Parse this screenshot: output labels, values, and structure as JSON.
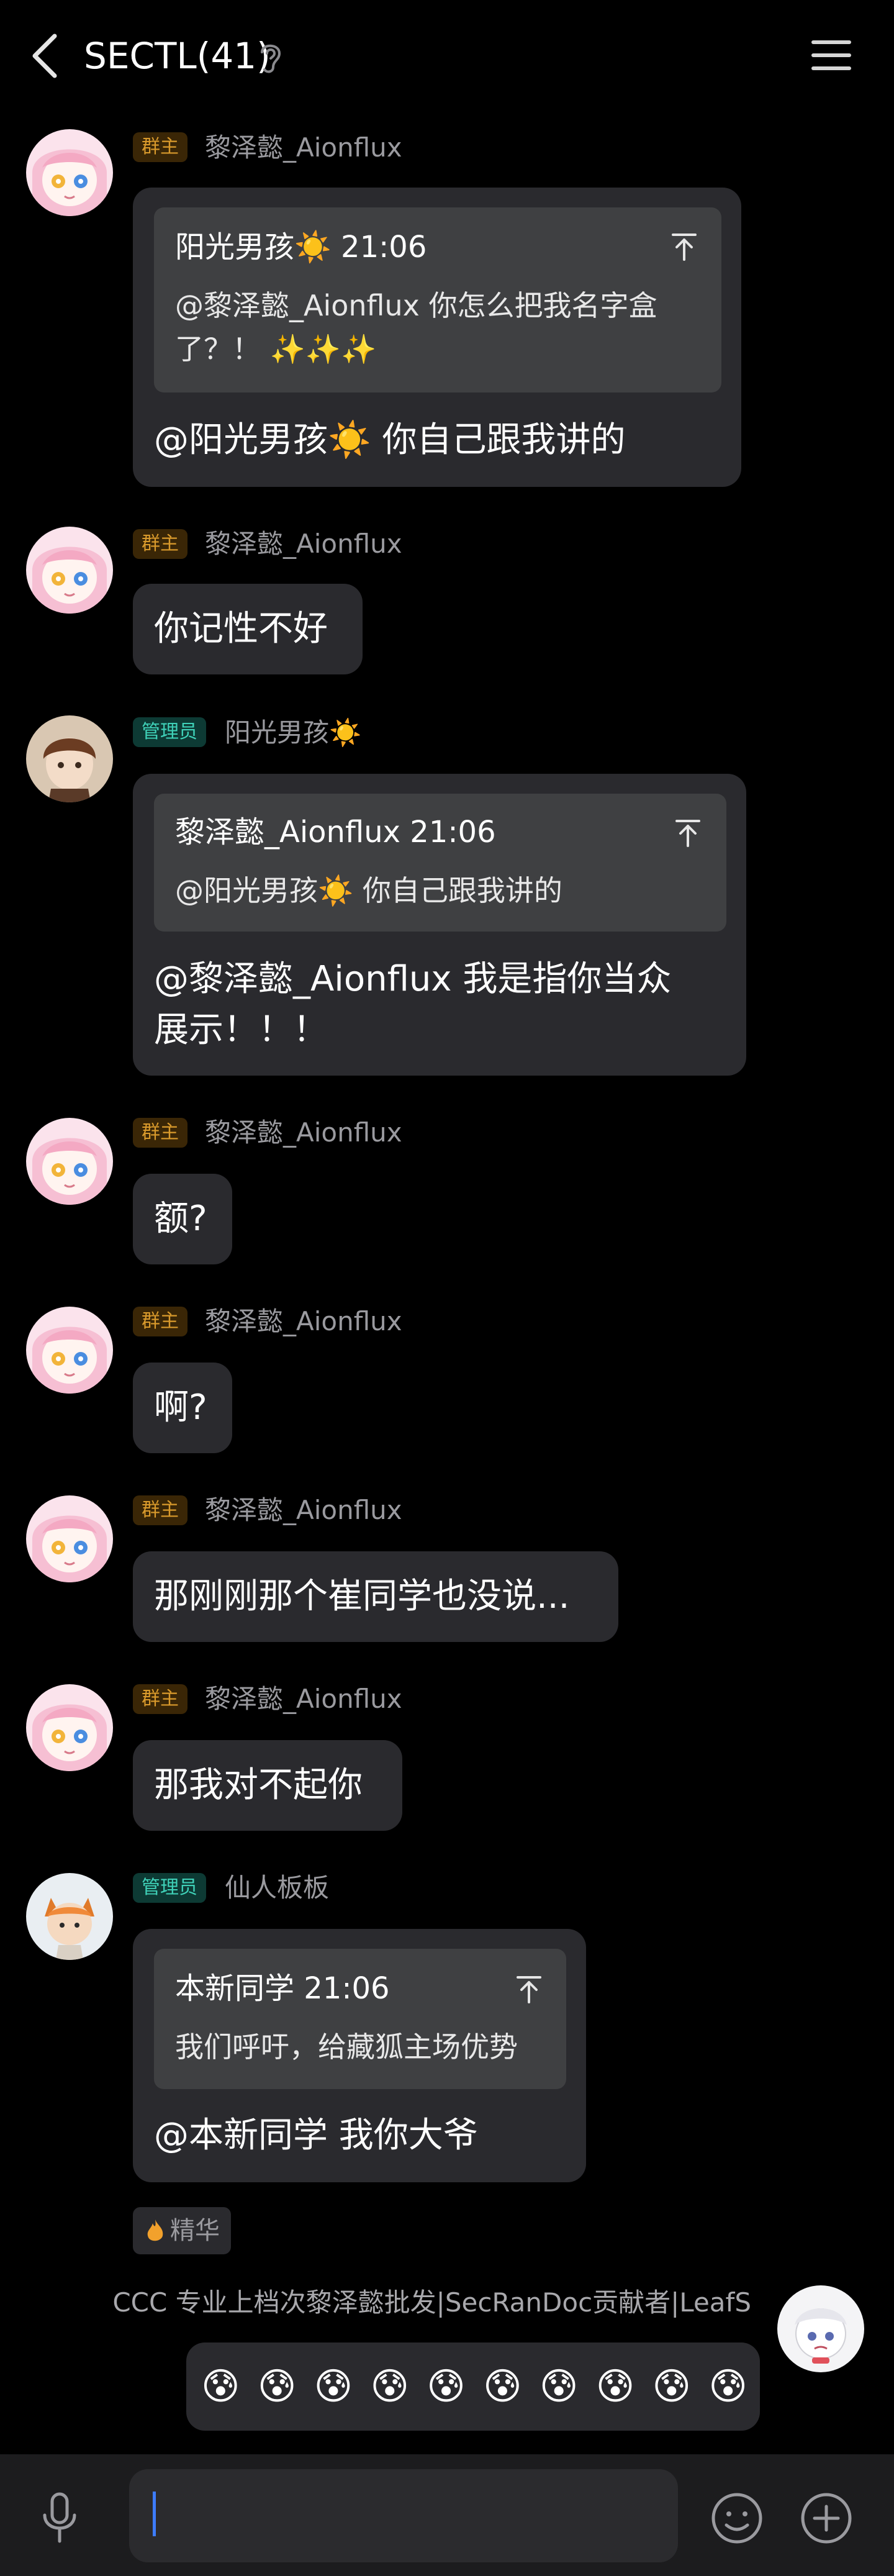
{
  "header": {
    "title": "SECTL(41)"
  },
  "colors": {
    "background": "#000000",
    "bubble": "#2a2a2e",
    "quote": "#3f4042",
    "owner_badge": "#d99a2c",
    "admin_badge": "#3fd1b8",
    "caret": "#3d7cff"
  },
  "icons": [
    "back-icon",
    "ear-icon",
    "menu-icon",
    "pin-to-top-icon",
    "fire-icon",
    "mic-icon",
    "smile-icon",
    "plus-icon"
  ],
  "messages": [
    {
      "role": "群主",
      "sender": "黎泽懿_Aionflux",
      "quote": {
        "head": "阳光男孩☀️ 21:06",
        "line1": "@黎泽懿_Aionflux 你怎么把我名字盒",
        "line2": "了？！ ✨✨✨"
      },
      "text": "@阳光男孩☀️ 你自己跟我讲的"
    },
    {
      "role": "群主",
      "sender": "黎泽懿_Aionflux",
      "text": "你记性不好"
    },
    {
      "role": "管理员",
      "sender": "阳光男孩☀️",
      "quote": {
        "head": "黎泽懿_Aionflux 21:06",
        "line1": "@阳光男孩☀️ 你自己跟我讲的"
      },
      "line1": "@黎泽懿_Aionflux 我是指你当众",
      "line2": "展示！！！"
    },
    {
      "role": "群主",
      "sender": "黎泽懿_Aionflux",
      "text": "额?"
    },
    {
      "role": "群主",
      "sender": "黎泽懿_Aionflux",
      "text": "啊?"
    },
    {
      "role": "群主",
      "sender": "黎泽懿_Aionflux",
      "text": "那刚刚那个崔同学也没说..."
    },
    {
      "role": "群主",
      "sender": "黎泽懿_Aionflux",
      "text": "那我对不起你"
    },
    {
      "role": "管理员",
      "sender": "仙人板板",
      "quote": {
        "head": "本新同学 21:06",
        "line1": "我们呼吁，给藏狐主场优势"
      },
      "text": "@本新同学 我你大爷",
      "tag": "精华"
    }
  ],
  "outgoing": {
    "signature": "CCC 专业上档次黎泽懿批发|SecRanDoc贡献者|LeafS",
    "emojis": [
      "😰",
      "😰",
      "😰",
      "😰",
      "😰",
      "😰",
      "😰",
      "😰",
      "😰",
      "😰"
    ]
  },
  "input": {
    "value": ""
  }
}
